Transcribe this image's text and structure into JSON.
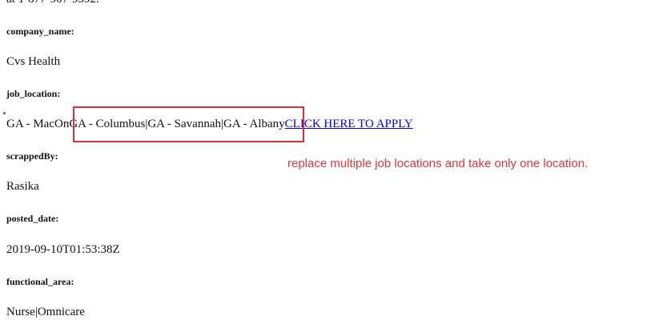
{
  "header_fragment": "at 1-877-907-9392.",
  "fields": {
    "company_name": {
      "label": "company_name:",
      "value": "Cvs Health"
    },
    "job_location": {
      "label": "job_location:",
      "value_first": "GA - MacOn",
      "value_highlighted": "GA - Columbus|GA - Savannah|GA - Albany",
      "apply_link": "CLICK HERE TO APPLY"
    },
    "scrappedBy": {
      "label": "scrappedBy:",
      "value": "Rasika"
    },
    "posted_date": {
      "label": "posted_date:",
      "value": "2019-09-10T01:53:38Z"
    },
    "functional_area": {
      "label": "functional_area:",
      "value": "Nurse|Omnicare"
    }
  },
  "annotation": {
    "text": "replace multiple job locations and take only one location.",
    "color": "#e0343e"
  },
  "colors": {
    "link": "#0000ee",
    "highlight_border": "#d9303a"
  }
}
